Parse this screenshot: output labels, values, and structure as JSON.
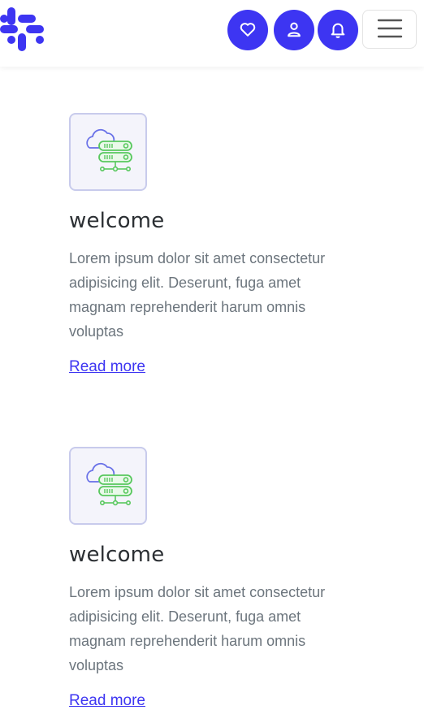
{
  "header": {
    "logo_icon": "slack-style-logo-icon",
    "brand_color": "#3d35f2",
    "buttons": [
      {
        "icon": "heart-icon"
      },
      {
        "icon": "user-icon"
      },
      {
        "icon": "bell-icon"
      }
    ],
    "menu_icon": "hamburger-menu-icon"
  },
  "cards": [
    {
      "icon": "cloud-server-icon",
      "title": "welcome",
      "text": "Lorem ipsum dolor sit amet consectetur adipisicing elit. Deserunt, fuga amet magnam reprehenderit harum omnis voluptas",
      "link": "Read more"
    },
    {
      "icon": "cloud-server-icon",
      "title": "welcome",
      "text": "Lorem ipsum dolor sit amet consectetur adipisicing elit. Deserunt, fuga amet magnam reprehenderit harum omnis voluptas",
      "link": "Read more"
    }
  ]
}
